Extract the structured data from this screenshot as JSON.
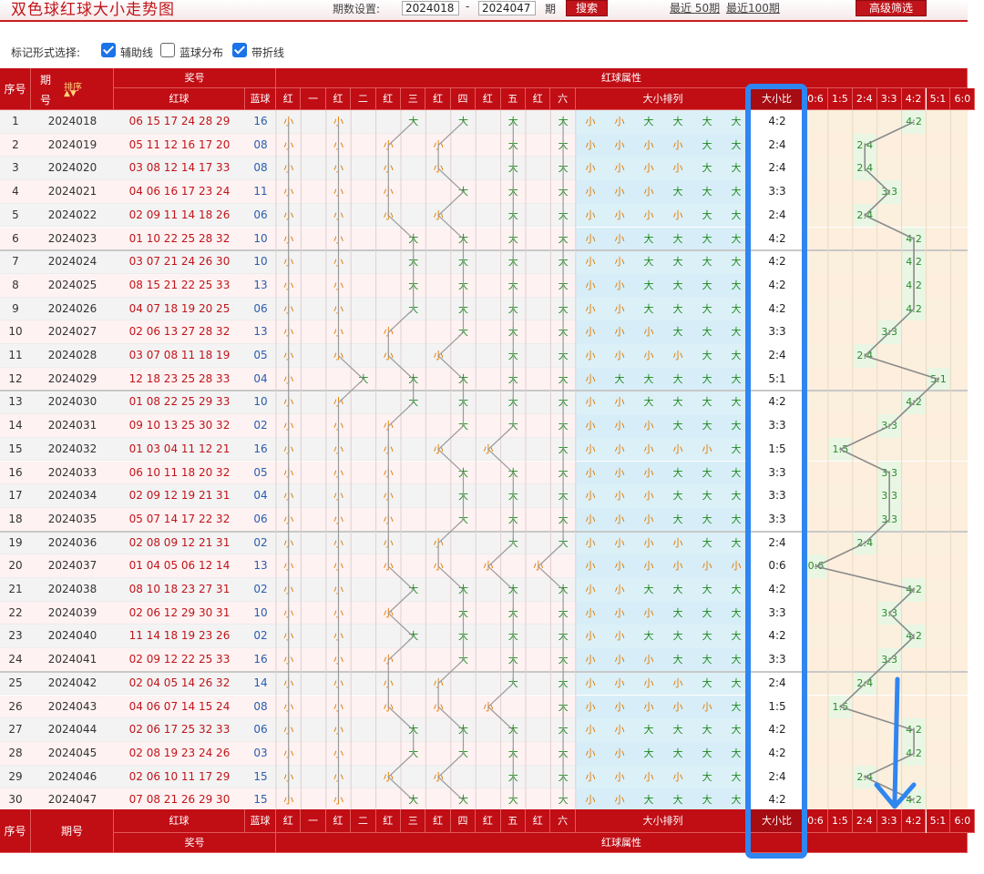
{
  "topbar": {
    "title": "双色球红球大小走势图",
    "period_label": "期数设置:",
    "start": "2024018",
    "dash": "-",
    "end": "2024047",
    "qi": "期",
    "search": "搜索",
    "recent50": "最近 50期",
    "recent100": "最近100期",
    "advanced": "高级筛选"
  },
  "marks": {
    "label": "标记形式选择:",
    "options": [
      {
        "label": "辅助线",
        "checked": true
      },
      {
        "label": "蓝球分布",
        "checked": false
      },
      {
        "label": "带折线",
        "checked": true
      }
    ]
  },
  "header": {
    "seq": "序号",
    "period": "期号",
    "period_short": "期",
    "period_sub": "号",
    "sort": "排序",
    "prize": "奖号",
    "red_attr": "红球属性",
    "red": "红球",
    "blue": "蓝球",
    "bs_arrange": "大小排列",
    "ratio": "大小比",
    "pos": [
      "红",
      "一",
      "红",
      "二",
      "红",
      "三",
      "红",
      "四",
      "红",
      "五",
      "红",
      "六"
    ],
    "ratios": [
      "0:6",
      "1:5",
      "2:4",
      "3:3",
      "4:2",
      "5:1",
      "6:0"
    ]
  },
  "symbols": {
    "big": "大",
    "small": "小"
  },
  "colors": {
    "accent": "#c10d14",
    "annotation": "#2f86f0",
    "big": "#1e8a1e",
    "small": "#e07b00",
    "blue_ball": "#2a5db0"
  },
  "rows": [
    {
      "n": "1",
      "p": "2024018",
      "red": "06 15 17 24 28 29",
      "blue": "16",
      "bs": "SSBBBB",
      "ratio": "4:2"
    },
    {
      "n": "2",
      "p": "2024019",
      "red": "05 11 12 16 17 20",
      "blue": "08",
      "bs": "SSSSBB",
      "ratio": "2:4"
    },
    {
      "n": "3",
      "p": "2024020",
      "red": "03 08 12 14 17 33",
      "blue": "08",
      "bs": "SSSSBB",
      "ratio": "2:4"
    },
    {
      "n": "4",
      "p": "2024021",
      "red": "04 06 16 17 23 24",
      "blue": "11",
      "bs": "SSSBBB",
      "ratio": "3:3"
    },
    {
      "n": "5",
      "p": "2024022",
      "red": "02 09 11 14 18 26",
      "blue": "06",
      "bs": "SSSSBB",
      "ratio": "2:4"
    },
    {
      "n": "6",
      "p": "2024023",
      "red": "01 10 22 25 28 32",
      "blue": "10",
      "bs": "SSBBBB",
      "ratio": "4:2"
    },
    {
      "n": "7",
      "p": "2024024",
      "red": "03 07 21 24 26 30",
      "blue": "10",
      "bs": "SSBBBB",
      "ratio": "4:2"
    },
    {
      "n": "8",
      "p": "2024025",
      "red": "08 15 21 22 25 33",
      "blue": "13",
      "bs": "SSBBBB",
      "ratio": "4:2"
    },
    {
      "n": "9",
      "p": "2024026",
      "red": "04 07 18 19 20 25",
      "blue": "06",
      "bs": "SSBBBB",
      "ratio": "4:2"
    },
    {
      "n": "10",
      "p": "2024027",
      "red": "02 06 13 27 28 32",
      "blue": "13",
      "bs": "SSSBBB",
      "ratio": "3:3"
    },
    {
      "n": "11",
      "p": "2024028",
      "red": "03 07 08 11 18 19",
      "blue": "05",
      "bs": "SSSSBB",
      "ratio": "2:4"
    },
    {
      "n": "12",
      "p": "2024029",
      "red": "12 18 23 25 28 33",
      "blue": "04",
      "bs": "SBBBBB",
      "ratio": "5:1"
    },
    {
      "n": "13",
      "p": "2024030",
      "red": "01 08 22 25 29 33",
      "blue": "10",
      "bs": "SSBBBB",
      "ratio": "4:2"
    },
    {
      "n": "14",
      "p": "2024031",
      "red": "09 10 13 25 30 32",
      "blue": "02",
      "bs": "SSSBBB",
      "ratio": "3:3"
    },
    {
      "n": "15",
      "p": "2024032",
      "red": "01 03 04 11 12 21",
      "blue": "16",
      "bs": "SSSSSB",
      "ratio": "1:5"
    },
    {
      "n": "16",
      "p": "2024033",
      "red": "06 10 11 18 20 32",
      "blue": "05",
      "bs": "SSSBBB",
      "ratio": "3:3"
    },
    {
      "n": "17",
      "p": "2024034",
      "red": "02 09 12 19 21 31",
      "blue": "04",
      "bs": "SSSBBB",
      "ratio": "3:3"
    },
    {
      "n": "18",
      "p": "2024035",
      "red": "05 07 14 17 22 32",
      "blue": "06",
      "bs": "SSSBBB",
      "ratio": "3:3"
    },
    {
      "n": "19",
      "p": "2024036",
      "red": "02 08 09 12 21 31",
      "blue": "02",
      "bs": "SSSSBB",
      "ratio": "2:4"
    },
    {
      "n": "20",
      "p": "2024037",
      "red": "01 04 05 06 12 14",
      "blue": "13",
      "bs": "SSSSSS",
      "ratio": "0:6"
    },
    {
      "n": "21",
      "p": "2024038",
      "red": "08 10 18 23 27 31",
      "blue": "02",
      "bs": "SSBBBB",
      "ratio": "4:2"
    },
    {
      "n": "22",
      "p": "2024039",
      "red": "02 06 12 29 30 31",
      "blue": "10",
      "bs": "SSSBBB",
      "ratio": "3:3"
    },
    {
      "n": "23",
      "p": "2024040",
      "red": "11 14 18 19 23 26",
      "blue": "02",
      "bs": "SSBBBB",
      "ratio": "4:2"
    },
    {
      "n": "24",
      "p": "2024041",
      "red": "02 09 12 22 25 33",
      "blue": "16",
      "bs": "SSSBBB",
      "ratio": "3:3"
    },
    {
      "n": "25",
      "p": "2024042",
      "red": "02 04 05 14 26 32",
      "blue": "14",
      "bs": "SSSSBB",
      "ratio": "2:4"
    },
    {
      "n": "26",
      "p": "2024043",
      "red": "04 06 07 14 15 24",
      "blue": "08",
      "bs": "SSSSSB",
      "ratio": "1:5"
    },
    {
      "n": "27",
      "p": "2024044",
      "red": "02 06 17 25 32 33",
      "blue": "06",
      "bs": "SSBBBB",
      "ratio": "4:2"
    },
    {
      "n": "28",
      "p": "2024045",
      "red": "02 08 19 23 24 26",
      "blue": "03",
      "bs": "SSBBBB",
      "ratio": "4:2"
    },
    {
      "n": "29",
      "p": "2024046",
      "red": "02 06 10 11 17 29",
      "blue": "15",
      "bs": "SSSSBB",
      "ratio": "2:4"
    },
    {
      "n": "30",
      "p": "2024047",
      "red": "07 08 21 26 29 30",
      "blue": "15",
      "bs": "SSBBBB",
      "ratio": "4:2"
    }
  ],
  "footer": {
    "seq": "序号",
    "period": "期号",
    "red": "红球",
    "blue": "蓝球",
    "bs_arrange": "大小排列",
    "ratio": "大小比",
    "prize": "奖号",
    "red_attr": "红球属性"
  }
}
